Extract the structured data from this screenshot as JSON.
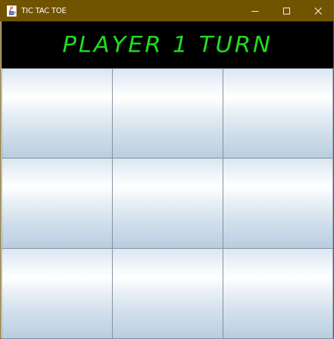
{
  "window": {
    "title": "TIC TAC TOE",
    "icon": "java-cup-icon",
    "controls": [
      "minimize-icon",
      "maximize-icon",
      "close-icon"
    ]
  },
  "header": {
    "turn_text": "PLAYER 1 TURN",
    "text_color": "#1fdc1f",
    "background": "#000000"
  },
  "board": {
    "cells": [
      [
        "",
        "",
        ""
      ],
      [
        "",
        "",
        ""
      ],
      [
        "",
        "",
        ""
      ]
    ]
  },
  "colors": {
    "titlebar": "#705400",
    "cell_border": "#7a8a99"
  }
}
